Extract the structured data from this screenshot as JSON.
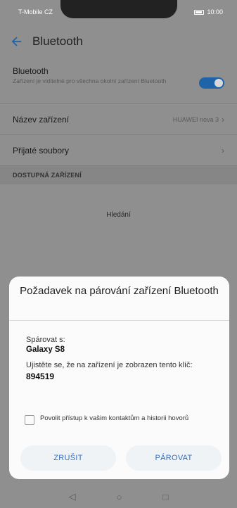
{
  "status": {
    "left": "T-Mobile CZ ",
    "right": "10:00"
  },
  "header": {
    "title": "Bluetooth"
  },
  "settings": {
    "bluetooth": {
      "title": "Bluetooth",
      "subtitle": "Zařízení je viditelné pro všechna okolní zařízení Bluetooth",
      "enabled": true
    },
    "device_name": {
      "label": "Název zařízení",
      "value": "HUAWEI nova 3"
    },
    "received_files": {
      "label": "Přijaté soubory"
    },
    "section_label": "DOSTUPNÁ ZAŘÍZENÍ",
    "searching": "Hledání"
  },
  "dialog": {
    "title": "Požadavek na párování zařízení Bluetooth",
    "pair_with_label": "Spárovat s:",
    "device": "Galaxy S8",
    "verify_text": "Ujistěte se, že na zařízení je zobrazen tento klíč:",
    "key": "894519",
    "allow_access_label": "Povolit přístup k vašim kontaktům a historii hovorů",
    "allow_access_checked": false,
    "cancel_label": "ZRUŠIT",
    "pair_label": "PÁROVAT"
  },
  "nav": {
    "back_icon": "triangle-back",
    "home_icon": "circle-home",
    "recents_icon": "square-recents"
  },
  "colors": {
    "accent": "#1f63a8",
    "button_text": "#2a6fc0"
  }
}
